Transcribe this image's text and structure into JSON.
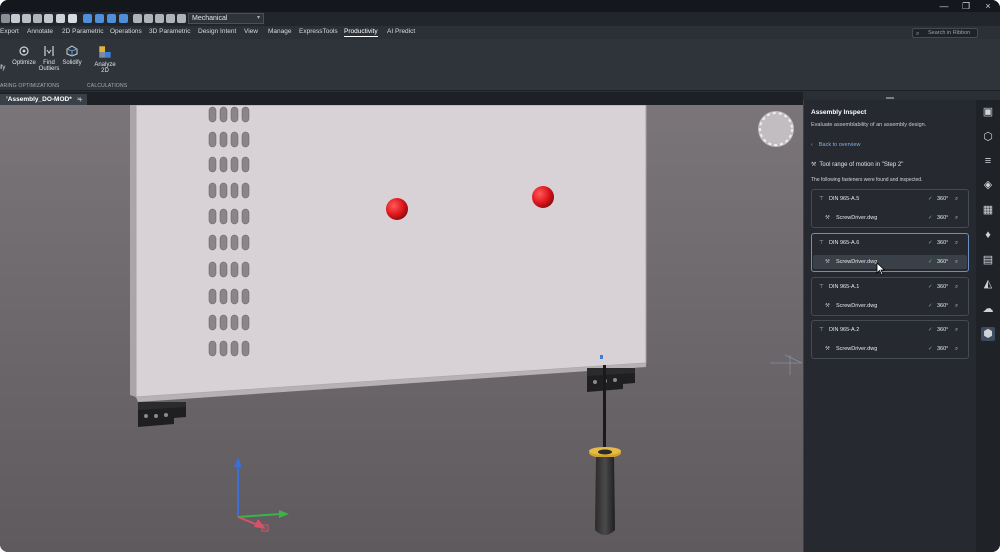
{
  "workspace": {
    "selected": "Mechanical"
  },
  "ribbon": {
    "tabs": [
      "Export",
      "Annotate",
      "2D Parametric",
      "Operations",
      "3D Parametric",
      "Design Intent",
      "View",
      "Manage",
      "ExpressTools",
      "Productivity",
      "AI Predict"
    ],
    "active_tab": "Productivity",
    "search_placeholder": "Search in Ribbon",
    "buttons": {
      "solidify_left": "lify",
      "optimize": "Optimize",
      "find_outliers_1": "Find",
      "find_outliers_2": "Outliers",
      "solidify": "Solidify",
      "analyze_2d_1": "Analyze",
      "analyze_2d_2": "2D"
    },
    "groups": {
      "optimizations": "ARING OPTIMIZATIONS",
      "calculations": "CALCULATIONS"
    }
  },
  "document": {
    "tab_label": "’Assembly_DO-MOD*",
    "close": "×",
    "add": "+"
  },
  "inspect": {
    "title": "Assembly Inspect",
    "description": "Evaluate assemblability of an assembly design.",
    "back": "Back to overview",
    "tool_range": "Tool range of motion in \"Step 2\"",
    "found_text": "The following fasteners were found and inspected.",
    "fasteners": [
      {
        "name": "DIN 965-A.5",
        "angle": "360°",
        "tool": "ScrewDriver.dwg",
        "tool_angle": "360°"
      },
      {
        "name": "DIN 965-A.6",
        "angle": "360°",
        "tool": "ScrewDriver.dwg",
        "tool_angle": "360°"
      },
      {
        "name": "DIN 965-A.1",
        "angle": "360°",
        "tool": "ScrewDriver.dwg",
        "tool_angle": "360°"
      },
      {
        "name": "DIN 965-A.2",
        "angle": "360°",
        "tool": "ScrewDriver.dwg",
        "tool_angle": "360°"
      }
    ]
  },
  "icons": {
    "check": "✓",
    "chevron_left": "‹",
    "window_minimize": "—",
    "window_restore": "❐"
  },
  "colors": {
    "accent": "#6b8fc0",
    "link": "#7fb0e6",
    "check": "#67c18a",
    "marker_red": "#e0161c",
    "panel_bg": "#262a30",
    "viewport_bg": "#6a6569"
  }
}
